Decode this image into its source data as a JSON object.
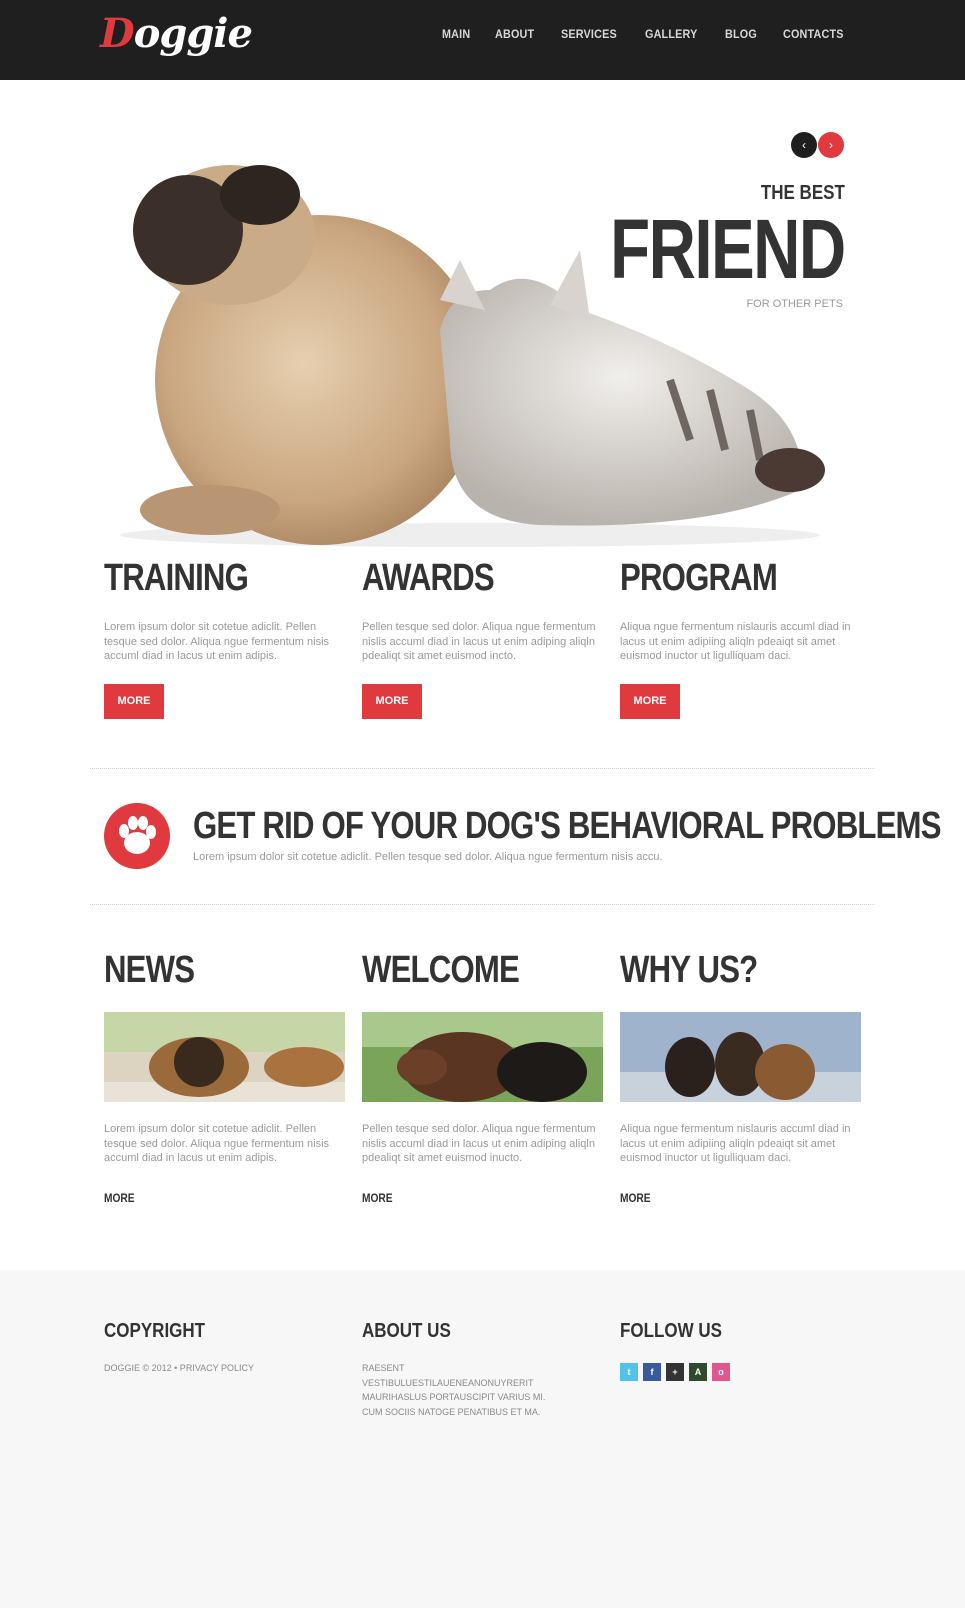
{
  "brand": {
    "logo_first": "D",
    "logo_rest": "oggie"
  },
  "nav": {
    "items": [
      "MAIN",
      "ABOUT",
      "SERVICES",
      "GALLERY",
      "BLOG",
      "CONTACTS"
    ]
  },
  "hero": {
    "prev_icon": "‹",
    "next_icon": "›",
    "kicker": "THE BEST",
    "headline": "FRIEND",
    "subline": "FOR OTHER PETS"
  },
  "features": [
    {
      "title": "TRAINING",
      "text": "Lorem ipsum dolor sit cotetue adiclit. Pellen tesque sed dolor. Aliqua ngue fermentum nisis accuml diad in lacus ut enim adipis.",
      "button": "MORE"
    },
    {
      "title": "AWARDS",
      "text": "Pellen tesque sed dolor. Aliqua ngue fermentum nislis accuml diad in lacus ut enim adiping aliqln pdealiqt sit amet euismod incto.",
      "button": "MORE"
    },
    {
      "title": "PROGRAM",
      "text": "Aliqua ngue fermentum nislauris accuml diad in lacus ut enim adipiing aliqln pdeaiqt sit amet euismod inuctor ut ligulliquam daci.",
      "button": "MORE"
    }
  ],
  "promo": {
    "icon": "paw-icon",
    "title": "GET RID OF YOUR DOG'S BEHAVIORAL PROBLEMS",
    "text": "Lorem ipsum dolor sit cotetue adiclit. Pellen tesque sed dolor. Aliqua ngue fermentum nisis accu."
  },
  "articles": [
    {
      "title": "NEWS",
      "image": "german-shepherd-lying-photo",
      "text": "Lorem ipsum dolor sit cotetue adiclit. Pellen tesque sed dolor. Aliqua ngue fermentum nisis accuml diad in lacus ut enim adipis.",
      "link": "MORE"
    },
    {
      "title": "WELCOME",
      "image": "dobermans-photo",
      "text": "Pellen tesque sed dolor. Aliqua ngue fermentum nislis accuml diad in lacus ut enim adiping aliqln pdealiqt sit amet euismod inucto.",
      "link": "MORE"
    },
    {
      "title": "WHY US?",
      "image": "three-shepherds-photo",
      "text": "Aliqua ngue fermentum nislauris accuml diad in lacus ut enim adipiing aliqln pdeaiqt sit amet euismod inuctor ut ligulliquam daci.",
      "link": "MORE"
    }
  ],
  "footer": {
    "copyright_title": "COPYRIGHT",
    "copyright_text": "DOGGIE © 2012 • PRIVACY POLICY",
    "about_title": "ABOUT US",
    "about_text": "RAESENT VESTIBULUESTILAUENEANONUYRERIT MAURIHASLUS PORTAUSCIPIT VARIUS MI. CUM SOCIIS NATOGE PENATIBUS ET MA.",
    "follow_title": "FOLLOW US",
    "social": [
      {
        "icon": "twitter-icon",
        "glyph": "t",
        "color": "#4fc3e8"
      },
      {
        "icon": "facebook-icon",
        "glyph": "f",
        "color": "#3b5a9a"
      },
      {
        "icon": "google-plus-icon",
        "glyph": "+",
        "color": "#333333"
      },
      {
        "icon": "picasa-icon",
        "glyph": "A",
        "color": "#2f4a2f"
      },
      {
        "icon": "dribbble-icon",
        "glyph": "o",
        "color": "#e0568f"
      }
    ]
  },
  "colors": {
    "accent": "#e03a3e",
    "dark": "#1f1f1f",
    "heading": "#333333",
    "body_text": "#9a9a9a",
    "footer_bg": "#f7f7f7"
  }
}
